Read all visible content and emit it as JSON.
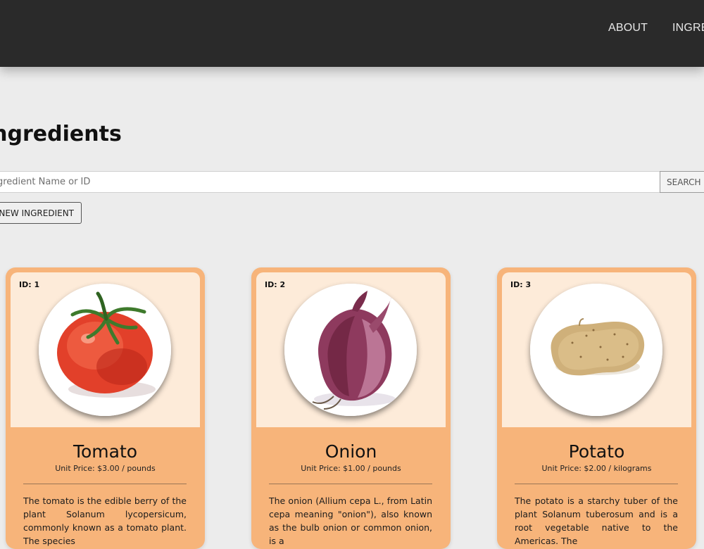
{
  "nav": {
    "links": [
      {
        "label": "ABOUT"
      },
      {
        "label": "INGRE"
      }
    ]
  },
  "page": {
    "title": "ngredients"
  },
  "search": {
    "placeholder": "gredient Name or ID",
    "button_label": "SEARCH",
    "button_icon": "search-icon"
  },
  "toolbar": {
    "new_label": "NEW INGREDIENT"
  },
  "cards": [
    {
      "id_label": "ID: 1",
      "name": "Tomato",
      "price": "Unit Price: $3.00 / pounds",
      "image": "tomato",
      "description": "The tomato is the edible berry of the plant Solanum lycopersicum, commonly known as a tomato plant. The species"
    },
    {
      "id_label": "ID: 2",
      "name": "Onion",
      "price": "Unit Price: $1.00 / pounds",
      "image": "onion",
      "description": "The onion (Allium cepa L., from Latin cepa meaning \"onion\"), also known as the bulb onion or common onion, is a"
    },
    {
      "id_label": "ID: 3",
      "name": "Potato",
      "price": "Unit Price: $2.00 / kilograms",
      "image": "potato",
      "description": "The potato is a starchy tuber of the plant Solanum tuberosum and is a root vegetable native to the Americas. The"
    }
  ],
  "colors": {
    "topbar": "#2a2a2a",
    "card": "#f7b47a",
    "card_top": "#fdebd9",
    "page_bg": "#ececec"
  }
}
